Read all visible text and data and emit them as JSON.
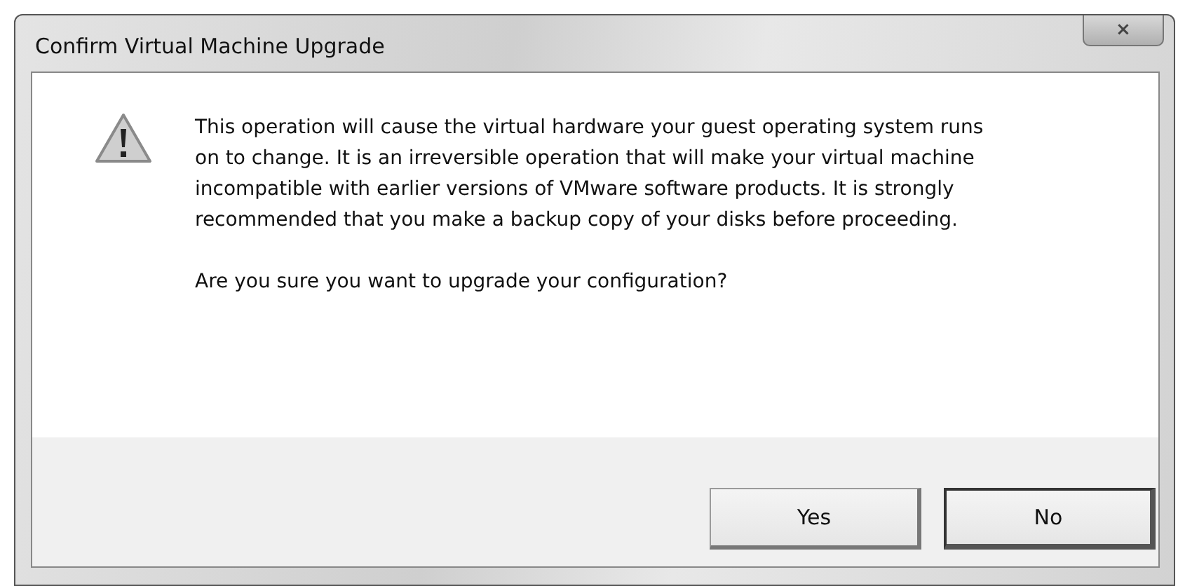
{
  "window": {
    "title": "Confirm Virtual Machine Upgrade",
    "close_button": "×"
  },
  "message": "This operation will cause the virtual hardware your guest operating system runs on to change. It is an irreversible operation that will make your virtual machine incompatible with earlier versions of VMware software products. It is strongly recommended that you make a backup copy of your disks before proceeding.",
  "question": "Are you sure you want to upgrade your configuration?",
  "buttons": [
    {
      "label": "Yes",
      "default": false
    },
    {
      "label": "No",
      "default": true
    }
  ]
}
